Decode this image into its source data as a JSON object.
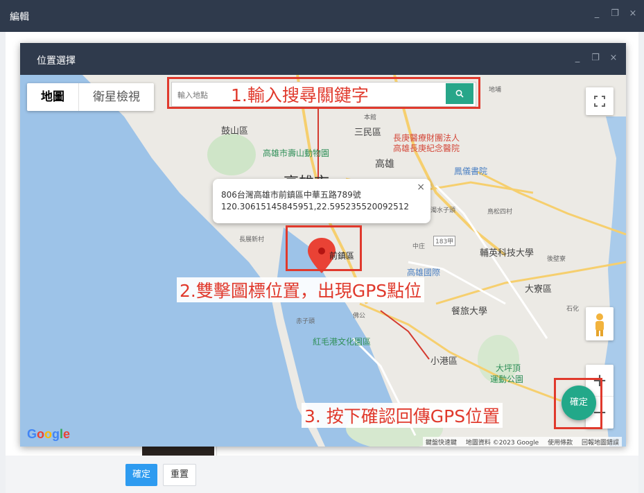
{
  "outer_window": {
    "title": "編輯",
    "controls": {
      "minimize": "_",
      "maximize": "❐",
      "close": "×"
    }
  },
  "footer": {
    "confirm_label": "確定",
    "reset_label": "重置"
  },
  "dialog": {
    "title": "位置選擇",
    "controls": {
      "minimize": "_",
      "maximize": "❐",
      "close": "×"
    }
  },
  "map": {
    "map_type": {
      "map": "地圖",
      "satellite": "衛星檢視"
    },
    "search": {
      "placeholder": "輸入地點",
      "button_icon": "search-icon"
    },
    "popup": {
      "address": "806台灣高雄市前鎮區中華五路789號",
      "coordinates": "120.30615145845951,22.595235520092512",
      "close": "×"
    },
    "labels": {
      "gushan": "鼓山區",
      "sanmin": "三民區",
      "changgung": "長庚醫療財團法人",
      "changgung2": "高雄長庚紀念醫院",
      "zoo": "高雄市壽山動物園",
      "kaohsiung": "高雄",
      "kaohsiung_big": "高雄市",
      "library": "鳳儀書院",
      "qianzhen": "前鎮區",
      "airport": "高雄國際",
      "daliao": "大寮區",
      "fooyin": "輔英科技大學",
      "hospitality": "餐旅大學",
      "pier": "紅毛港文化園區",
      "xiaogang": "小港區",
      "dapingding": "大坪頂",
      "park": "運動公園",
      "road183": "183甲",
      "zhongpu": "中庄",
      "dadong": "鳥松四村",
      "changxin": "長展新村",
      "shizi": "濁水子頭",
      "foz": "佛公",
      "chizi": "赤子頭",
      "xiaogang_top": "地埔",
      "benguan": "本館",
      "houliao": "後壁寮",
      "shihua": "石化"
    },
    "attribution": {
      "shortcuts": "鍵盤快速鍵",
      "data": "地圖資料 ©2023 Google",
      "terms": "使用條款",
      "report": "回報地圖錯誤"
    },
    "confirm_fab": "確定",
    "zoom_in": "+",
    "zoom_out": "−"
  },
  "annotations": {
    "step1": "1.輸入搜尋關鍵字",
    "step2": "2.雙擊圖標位置，出現GPS點位",
    "step3": "3. 按下確認回傳GPS位置"
  },
  "colors": {
    "titlebar": "#2f3a4c",
    "accent_green": "#22a889",
    "primary_blue": "#2e9bf0",
    "annotation_red": "#e0392c",
    "water": "#9dc3e8",
    "land": "#eceae5"
  }
}
